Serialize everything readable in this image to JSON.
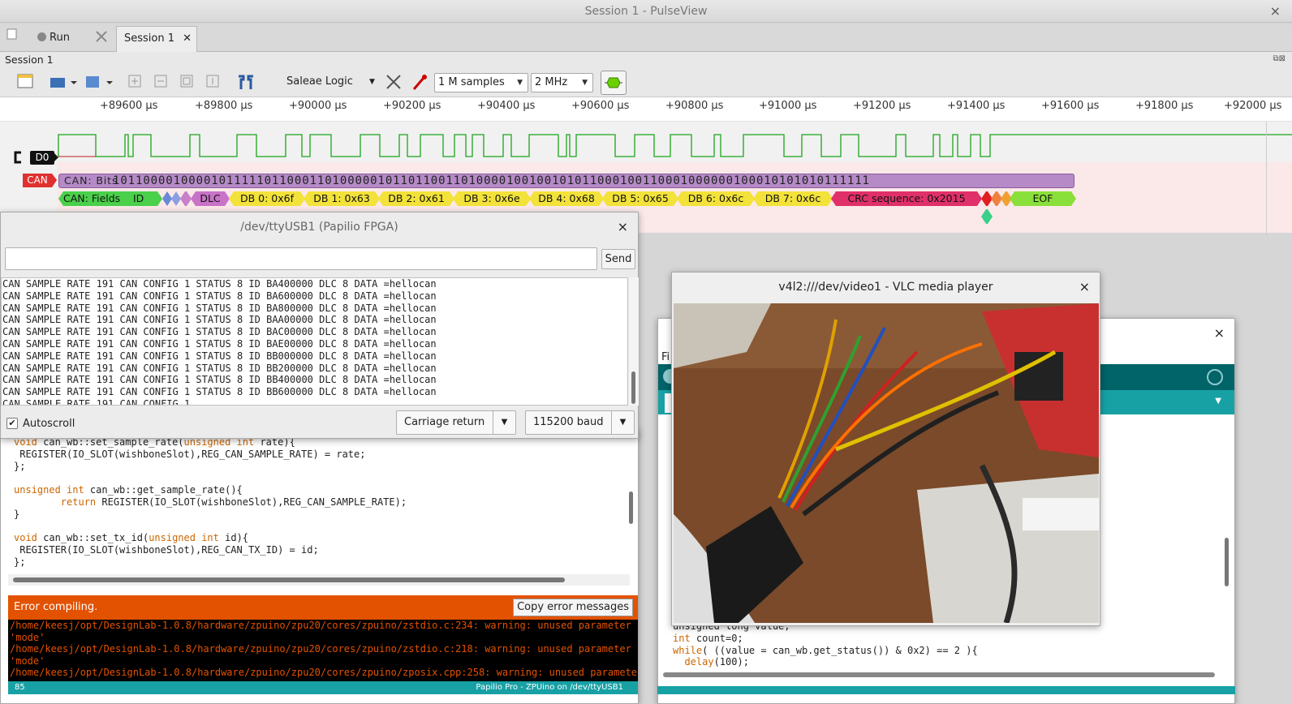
{
  "window": {
    "title": "Session 1 - PulseView",
    "close": "×"
  },
  "tabs": {
    "run_label": "Run",
    "session_tab_label": "Session 1",
    "session_tab_close": "✕"
  },
  "session_label": "Session 1",
  "toolbar": {
    "device": "Saleae Logic",
    "samples": "1 M samples",
    "rate": "2 MHz"
  },
  "ruler": {
    "ticks": [
      "+89600 µs",
      "+89800 µs",
      "+90000 µs",
      "+90200 µs",
      "+90400 µs",
      "+90600 µs",
      "+90800 µs",
      "+91000 µs",
      "+91200 µs",
      "+91400 µs",
      "+91600 µs",
      "+91800 µs",
      "+92000 µs"
    ]
  },
  "channels": {
    "d0_label": "D0",
    "can_label": "CAN",
    "can_bits_label": "CAN: Bits",
    "can_bits": "1011000010000101111101100011010000010110110011010000100100101011000100110001000000100010101010111111",
    "can_fields_label": "CAN: Fields",
    "fields": [
      "ID",
      "DLC",
      "DB 0: 0x6f",
      "DB 1: 0x63",
      "DB 2: 0x61",
      "DB 3: 0x6e",
      "DB 4: 0x68",
      "DB 5: 0x65",
      "DB 6: 0x6c",
      "DB 7: 0x6c",
      "CRC sequence: 0x2015",
      "EOF"
    ]
  },
  "serial": {
    "title": "/dev/ttyUSB1 (Papilio FPGA)",
    "input_value": "",
    "send_label": "Send",
    "log": [
      "CAN SAMPLE RATE 191 CAN CONFIG 1 STATUS 8 ID BA400000 DLC 8 DATA =hellocan",
      "CAN SAMPLE RATE 191 CAN CONFIG 1 STATUS 8 ID BA600000 DLC 8 DATA =hellocan",
      "CAN SAMPLE RATE 191 CAN CONFIG 1 STATUS 8 ID BA800000 DLC 8 DATA =hellocan",
      "CAN SAMPLE RATE 191 CAN CONFIG 1 STATUS 8 ID BAA00000 DLC 8 DATA =hellocan",
      "CAN SAMPLE RATE 191 CAN CONFIG 1 STATUS 8 ID BAC00000 DLC 8 DATA =hellocan",
      "CAN SAMPLE RATE 191 CAN CONFIG 1 STATUS 8 ID BAE00000 DLC 8 DATA =hellocan",
      "CAN SAMPLE RATE 191 CAN CONFIG 1 STATUS 8 ID BB000000 DLC 8 DATA =hellocan",
      "CAN SAMPLE RATE 191 CAN CONFIG 1 STATUS 8 ID BB200000 DLC 8 DATA =hellocan",
      "CAN SAMPLE RATE 191 CAN CONFIG 1 STATUS 8 ID BB400000 DLC 8 DATA =hellocan",
      "CAN SAMPLE RATE 191 CAN CONFIG 1 STATUS 8 ID BB600000 DLC 8 DATA =hellocan",
      "CAN SAMPLE RATE 191 CAN CONFIG 1"
    ],
    "autoscroll_label": "Autoscroll",
    "line_ending": "Carriage return",
    "baud": "115200 baud"
  },
  "editor": {
    "code_lines": [
      "void can_wb::set_sample_rate(unsigned int rate){",
      " REGISTER(IO_SLOT(wishboneSlot),REG_CAN_SAMPLE_RATE) = rate;",
      "};",
      "",
      "unsigned int can_wb::get_sample_rate(){",
      "        return REGISTER(IO_SLOT(wishboneSlot),REG_CAN_SAMPLE_RATE);",
      "}",
      "",
      "void can_wb::set_tx_id(unsigned int id){",
      " REGISTER(IO_SLOT(wishboneSlot),REG_CAN_TX_ID) = id;",
      "};"
    ],
    "error_title": "Error compiling.",
    "copy_errors_label": "Copy error messages",
    "error_log": [
      "/home/keesj/opt/DesignLab-1.0.8/hardware/zpuino/zpu20/cores/zpuino/zstdio.c:234: warning: unused parameter",
      "'mode'",
      "/home/keesj/opt/DesignLab-1.0.8/hardware/zpuino/zpu20/cores/zpuino/zstdio.c:218: warning: unused parameter",
      "'mode'",
      "/home/keesj/opt/DesignLab-1.0.8/hardware/zpuino/zpu20/cores/zpuino/zposix.cpp:258: warning: unused parameter"
    ],
    "status_line": "85",
    "status_board": "Papilio Pro - ZPUino on /dev/ttyUSB1"
  },
  "editor2": {
    "menu_fragment": "Fi",
    "code_lines": [
      "unsigned long value;",
      "int count=0;",
      "while( ((value = can_wb.get_status()) & 0x2) == 2 ){",
      "  delay(100);"
    ]
  },
  "vlc": {
    "title": "v4l2:///dev/video1 - VLC media player",
    "close": "×"
  },
  "colors": {
    "accent_teal": "#17a1a5",
    "error_orange": "#e35200",
    "can_red": "#e03030",
    "bits_purple": "#b58ac7"
  }
}
